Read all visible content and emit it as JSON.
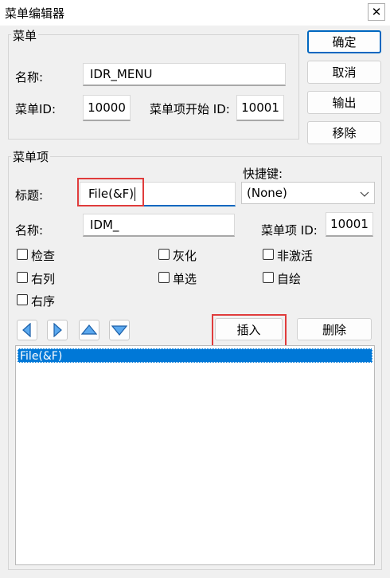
{
  "window": {
    "title": "菜单编辑器",
    "close_glyph": "✕"
  },
  "menu_group": {
    "label": "菜单",
    "name_label": "名称:",
    "name_value": "IDR_MENU",
    "id_label": "菜单ID:",
    "id_value": "10000",
    "start_id_label": "菜单项开始 ID:",
    "start_id_value": "10001"
  },
  "buttons": {
    "ok": "确定",
    "cancel": "取消",
    "export": "输出",
    "remove": "移除",
    "insert": "插入",
    "delete": "删除"
  },
  "item_group": {
    "label": "菜单项",
    "caption_label": "标题:",
    "caption_value": "File(&F)",
    "shortcut_label": "快捷键:",
    "shortcut_value": "(None)",
    "name_label": "名称:",
    "name_value": "IDM_",
    "item_id_label": "菜单项 ID:",
    "item_id_value": "10001",
    "checkboxes": [
      "检查",
      "灰化",
      "非激活",
      "右列",
      "单选",
      "自绘",
      "右序"
    ]
  },
  "tree": {
    "items": [
      "File(&F)"
    ]
  },
  "colors": {
    "accent": "#0067c0",
    "selection": "#0078d7",
    "highlight_box": "#e03c3c"
  }
}
